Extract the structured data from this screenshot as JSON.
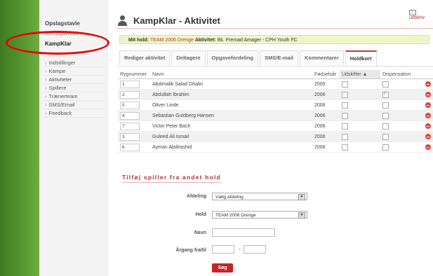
{
  "sidebar": {
    "title": "Opslagstavle",
    "subtitle": "Min opgaveliste",
    "current": "KampKlar",
    "items": [
      {
        "label": "Indstillinger"
      },
      {
        "label": "Kampe"
      },
      {
        "label": "Aktiviteter"
      },
      {
        "label": "Spillere"
      },
      {
        "label": "Trænerteam"
      },
      {
        "label": "SMS/Email"
      },
      {
        "label": "Feedback"
      }
    ]
  },
  "header": {
    "title": "KampKlar - Aktivitet",
    "print_label": "udskriv"
  },
  "infobar": {
    "hold_label": "Mit hold:",
    "hold_value": "TEAM 2006 Drenge",
    "activity_label": "Aktivitet:",
    "activity_value": "Bk. Fremad Amager - CPH Youth FC"
  },
  "tabs": [
    {
      "label": "Rediger aktivitet"
    },
    {
      "label": "Deltagere"
    },
    {
      "label": "Opgavefordeling"
    },
    {
      "label": "SMS/E-mail"
    },
    {
      "label": "Kommentarer"
    },
    {
      "label": "Holdkort"
    }
  ],
  "table": {
    "headers": [
      "Rygnummer",
      "Navn",
      "Fødselsår",
      "Udskifter ▲",
      "Dispensation",
      ""
    ],
    "rows": [
      {
        "number": "1",
        "name": "Abdimalik Salad Dhalin",
        "year": "2005",
        "sub": false,
        "disp": false
      },
      {
        "number": "2",
        "name": "Abdullah Ibrahim",
        "year": "2006",
        "sub": false,
        "disp": true
      },
      {
        "number": "5",
        "name": "Oliver Linde",
        "year": "2006",
        "sub": false,
        "disp": false
      },
      {
        "number": "4",
        "name": "Sebastian Guldberg Hansen",
        "year": "2006",
        "sub": false,
        "disp": false
      },
      {
        "number": "7",
        "name": "Victor Peter Bach",
        "year": "2006",
        "sub": false,
        "disp": false
      },
      {
        "number": "3",
        "name": "Guleed Ali Ismail",
        "year": "2006",
        "sub": false,
        "disp": false
      },
      {
        "number": "6",
        "name": "Ayman Abdirashid",
        "year": "2006",
        "sub": false,
        "disp": false
      }
    ]
  },
  "form": {
    "title": "Tilføj spiller fra andet hold",
    "afdeling_label": "Afdeling",
    "afdeling_value": "Vælg afdeling",
    "hold_label": "Hold",
    "hold_value": "TEAM 2006 Drenge",
    "navn_label": "Navn",
    "aargang_label": "Årgang fra/til",
    "dash": "-",
    "search_label": "Søg"
  }
}
